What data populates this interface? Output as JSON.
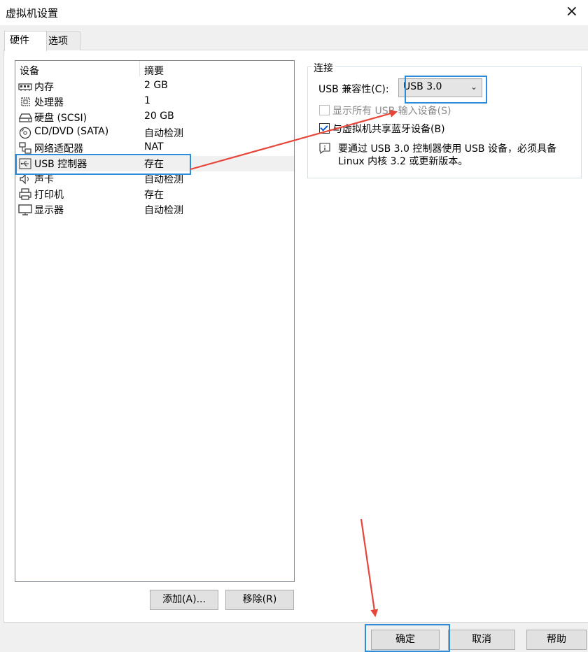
{
  "window": {
    "title": "虚拟机设置",
    "close_glyph": "×"
  },
  "tabs": [
    {
      "label": "硬件"
    },
    {
      "label": "选项"
    }
  ],
  "device_list": {
    "col_device": "设备",
    "col_summary": "摘要",
    "rows": [
      {
        "name": "内存",
        "summary": "2 GB",
        "icon": "memory-icon"
      },
      {
        "name": "处理器",
        "summary": "1",
        "icon": "processor-icon"
      },
      {
        "name": "硬盘 (SCSI)",
        "summary": "20 GB",
        "icon": "hard-disk-icon"
      },
      {
        "name": "CD/DVD (SATA)",
        "summary": "自动检测",
        "icon": "cd-dvd-icon"
      },
      {
        "name": "网络适配器",
        "summary": "NAT",
        "icon": "network-adapter-icon"
      },
      {
        "name": "USB 控制器",
        "summary": "存在",
        "icon": "usb-icon"
      },
      {
        "name": "声卡",
        "summary": "自动检测",
        "icon": "sound-card-icon"
      },
      {
        "name": "打印机",
        "summary": "存在",
        "icon": "printer-icon"
      },
      {
        "name": "显示器",
        "summary": "自动检测",
        "icon": "display-icon"
      }
    ]
  },
  "buttons": {
    "add": "添加(A)...",
    "remove": "移除(R)",
    "ok": "确定",
    "cancel": "取消",
    "help": "帮助"
  },
  "connection": {
    "group_title": "连接",
    "usb_compat_label": "USB 兼容性(C):",
    "usb_compat_value": "USB 3.0",
    "show_all_usb_label": "显示所有 USB 输入设备(S)",
    "share_bluetooth_label": "与虚拟机共享蓝牙设备(B)",
    "info_line1": "要通过 USB 3.0 控制器使用 USB 设备，必须具备",
    "info_line2": "Linux 内核 3.2 或更新版本。"
  },
  "colors": {
    "highlight": "#2f8cd8",
    "arrow": "#e8453a"
  }
}
